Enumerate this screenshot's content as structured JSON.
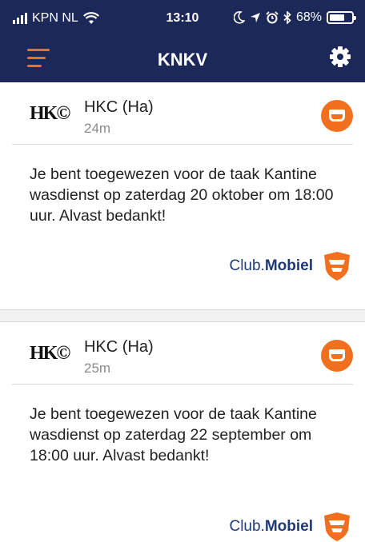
{
  "status_bar": {
    "carrier": "KPN NL",
    "time": "13:10",
    "battery": "68%",
    "battery_level": 0.68
  },
  "nav": {
    "title": "KNKV",
    "menu_icon": "hamburger-menu-icon",
    "settings_icon": "gear-icon"
  },
  "colors": {
    "navbar": "#1c2858",
    "accent": "#f07020",
    "brand_blue": "#1f3a74"
  },
  "notifications": [
    {
      "logo": "HK©",
      "sender": "HKC (Ha)",
      "age": "24m",
      "action_icon": "coffee-mug-icon",
      "message": "Je bent toegewezen voor de taak Kantine wasdienst op zaterdag 20 oktober om 18:00 uur. Alvast bedankt!",
      "brand_club": "Club.",
      "brand_name": "Mobiel"
    },
    {
      "logo": "HK©",
      "sender": "HKC (Ha)",
      "age": "25m",
      "action_icon": "coffee-mug-icon",
      "message": "Je bent toegewezen voor de taak Kantine wasdienst op zaterdag 22 september om 18:00 uur. Alvast bedankt!",
      "brand_club": "Club.",
      "brand_name": "Mobiel"
    }
  ]
}
